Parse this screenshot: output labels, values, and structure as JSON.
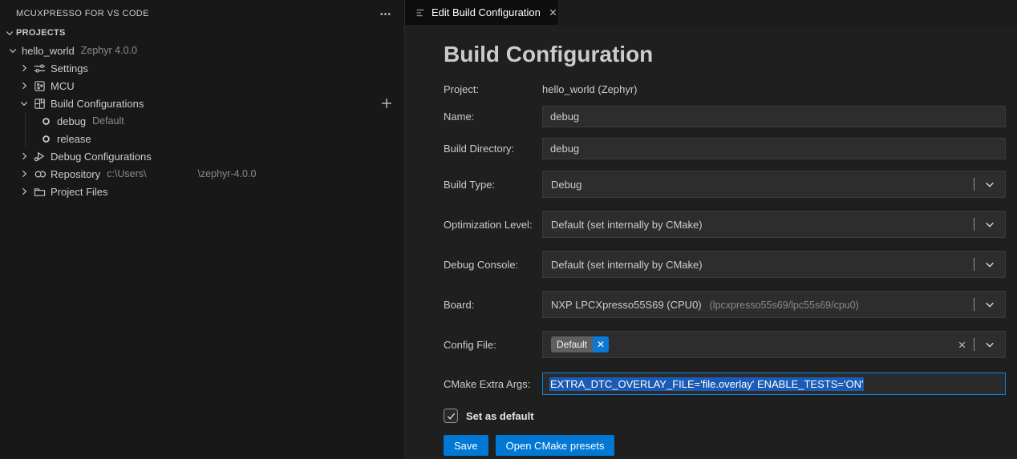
{
  "colors": {
    "accent": "#0078d4",
    "selection_blue": "#1a5bb5",
    "sidebar_bg": "#181818",
    "editor_bg": "#1f1f1f"
  },
  "sidebar": {
    "title": "MCUXPRESSO FOR VS CODE",
    "sections": {
      "projects": "PROJECTS"
    },
    "tree": [
      {
        "label": "hello_world",
        "meta": "Zephyr 4.0.0"
      },
      {
        "label": "Settings"
      },
      {
        "label": "MCU"
      },
      {
        "label": "Build Configurations"
      },
      {
        "label": "debug",
        "meta": "Default"
      },
      {
        "label": "release"
      },
      {
        "label": "Debug Configurations"
      },
      {
        "label": "Repository",
        "meta": "c:\\Users\\",
        "meta2": "\\zephyr-4.0.0"
      },
      {
        "label": "Project Files"
      }
    ]
  },
  "tab": {
    "title": "Edit Build Configuration"
  },
  "form": {
    "title": "Build Configuration",
    "project": {
      "label": "Project:",
      "value": "hello_world (Zephyr)"
    },
    "name": {
      "label": "Name:",
      "value": "debug"
    },
    "build_directory": {
      "label": "Build Directory:",
      "value": "debug"
    },
    "build_type": {
      "label": "Build Type:",
      "value": "Debug"
    },
    "optimization_level": {
      "label": "Optimization Level:",
      "value": "Default (set internally by CMake)"
    },
    "debug_console": {
      "label": "Debug Console:",
      "value": "Default (set internally by CMake)"
    },
    "board": {
      "label": "Board:",
      "value": "NXP LPCXpresso55S69 (CPU0)",
      "detail": "(lpcxpresso55s69/lpc55s69/cpu0)"
    },
    "config_file": {
      "label": "Config File:",
      "chip": "Default"
    },
    "cmake_extra_args": {
      "label": "CMake Extra Args:",
      "value": "EXTRA_DTC_OVERLAY_FILE='file.overlay' ENABLE_TESTS='ON'"
    },
    "set_as_default": {
      "label": "Set as default",
      "checked": true
    },
    "buttons": {
      "save": "Save",
      "open_presets": "Open CMake presets"
    }
  }
}
